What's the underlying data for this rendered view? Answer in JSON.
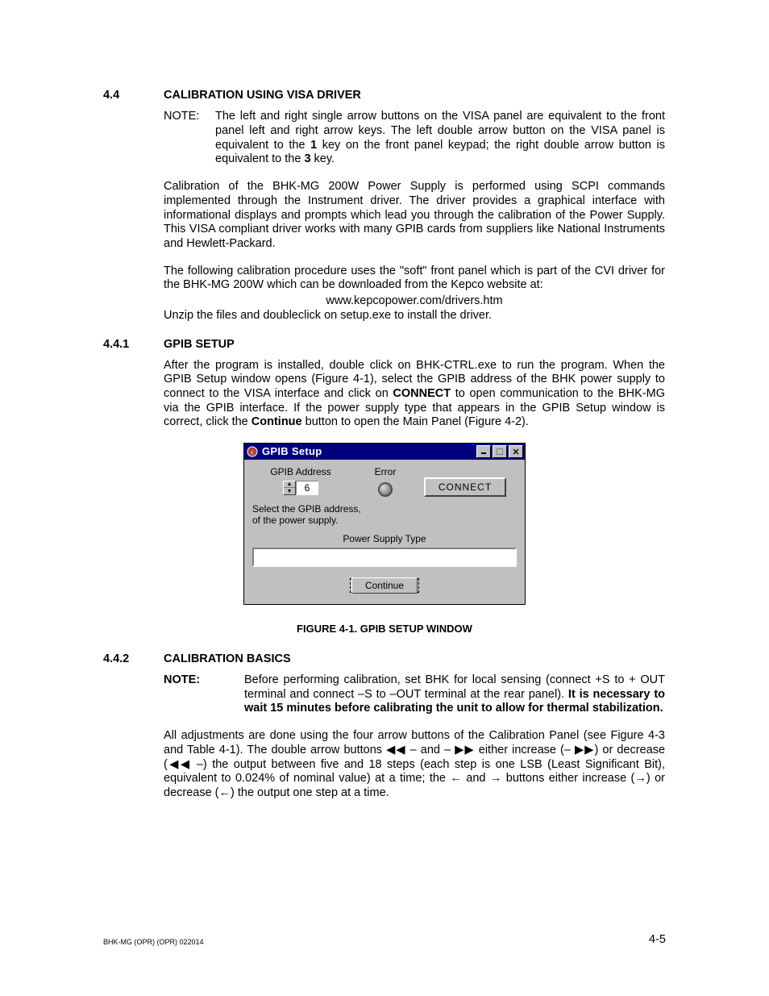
{
  "section_4_4": {
    "num": "4.4",
    "title": "CALIBRATION USING VISA DRIVER",
    "note_label": "NOTE:",
    "note_text_a": "The left and right single arrow buttons on the VISA panel are equivalent to the front panel left and right arrow keys. The left double arrow button on the VISA panel is equivalent to the ",
    "note_bold_1": "1",
    "note_text_b": " key on the front panel keypad; the right double arrow button is equivalent to the ",
    "note_bold_3": "3",
    "note_text_c": " key.",
    "p1": "Calibration of the BHK-MG 200W Power Supply is performed using SCPI commands implemented through the Instrument driver. The driver provides a graphical interface with informational displays and prompts which lead you through the calibration of the Power Supply. This VISA compliant driver works with many GPIB cards from suppliers like National Instruments and Hewlett-Packard.",
    "p2a": "The following calibration procedure uses the \"soft\" front panel which is part of the CVI driver for the BHK-MG 200W which can be downloaded from the Kepco website at:",
    "p2_url": "www.kepcopower.com/drivers.htm",
    "p2b": "Unzip the files and doubleclick on setup.exe to install the driver."
  },
  "section_4_4_1": {
    "num": "4.4.1",
    "title": "GPIB SETUP",
    "p1a": "After the program is installed, double click on BHK-CTRL.exe to run the program. When the GPIB Setup window opens (Figure 4-1), select the GPIB address of the BHK power supply to connect to the VISA interface and click on ",
    "p1_connect": "CONNECT",
    "p1b": " to open communication to the BHK-MG via the GPIB interface. If the power supply type that appears in the GPIB Setup window is correct, click the ",
    "p1_continue": "Continue",
    "p1c": " button to open the Main Panel (Figure 4-2)."
  },
  "dialog": {
    "title": "GPIB Setup",
    "gpib_label": "GPIB Address",
    "gpib_value": "6",
    "error_label": "Error",
    "connect_btn": "CONNECT",
    "select_text1": "Select the GPIB address,",
    "select_text2": "of the power supply.",
    "pst_label": "Power Supply Type",
    "continue_btn": "Continue"
  },
  "figure_caption": "FIGURE 4-1.  GPIB SETUP WINDOW",
  "section_4_4_2": {
    "num": "4.4.2",
    "title": "CALIBRATION BASICS",
    "note_label": "NOTE:",
    "note_a": "Before performing calibration, set BHK for local sensing (connect +S to + OUT terminal and connect –S to –OUT terminal at the rear panel). ",
    "note_bold": "It is necessary to wait 15 minutes before calibrating the unit to allow for thermal stabilization.",
    "p1a": "All adjustments are done using the four arrow buttons of the Calibration Panel (see Figure 4-3 and Table 4-1). The double arrow buttons ",
    "dbl_left": "◀◀",
    "dash1": " – and – ",
    "dbl_right": "▶▶",
    "p1b": " either increase (",
    "dash2": "– ",
    "p1c": ") or decrease (",
    "dash3": " –",
    "p1d": ") the output between five and 18 steps (each step is one LSB (Least Significant Bit), equivalent to 0.024% of nominal value) at a time; the ",
    "single_left": "←",
    "and": " and ",
    "single_right": "→",
    "p1e": " buttons either increase (",
    "p1f": ") or decrease (",
    "p1g": ") the output one step at a time."
  },
  "footer": {
    "left": "BHK-MG (OPR) (OPR) 022014",
    "right": "4-5"
  }
}
